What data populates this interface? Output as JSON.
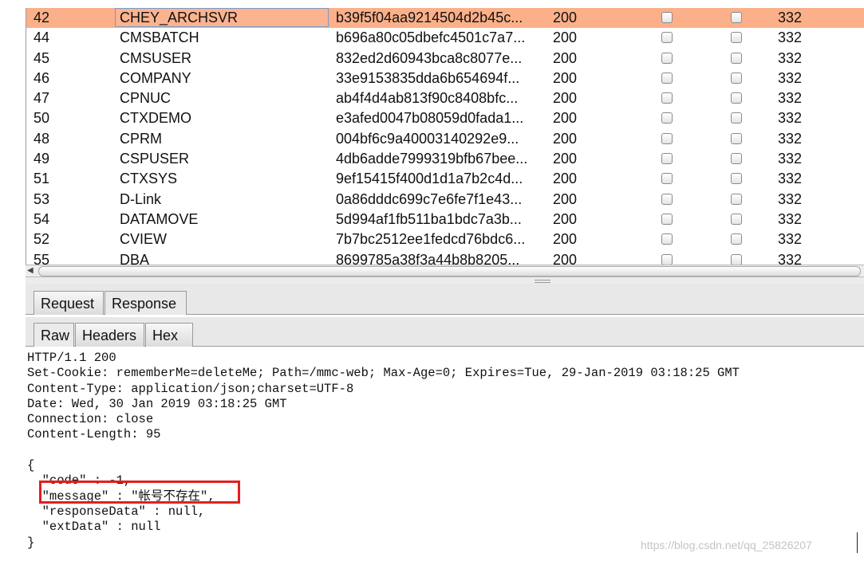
{
  "results": [
    {
      "num": "42",
      "user": "CHEY_ARCHSVR",
      "pass": "b39f5f04aa9214504d2b45c...",
      "status": "200",
      "len": "332"
    },
    {
      "num": "44",
      "user": "CMSBATCH",
      "pass": "b696a80c05dbefc4501c7a7...",
      "status": "200",
      "len": "332"
    },
    {
      "num": "45",
      "user": "CMSUSER",
      "pass": "832ed2d60943bca8c8077e...",
      "status": "200",
      "len": "332"
    },
    {
      "num": "46",
      "user": "COMPANY",
      "pass": "33e9153835dda6b654694f...",
      "status": "200",
      "len": "332"
    },
    {
      "num": "47",
      "user": "CPNUC",
      "pass": "ab4f4d4ab813f90c8408bfc...",
      "status": "200",
      "len": "332"
    },
    {
      "num": "50",
      "user": "CTXDEMO",
      "pass": "e3afed0047b08059d0fada1...",
      "status": "200",
      "len": "332"
    },
    {
      "num": "48",
      "user": "CPRM",
      "pass": "004bf6c9a40003140292e9...",
      "status": "200",
      "len": "332"
    },
    {
      "num": "49",
      "user": "CSPUSER",
      "pass": "4db6adde7999319bfb67bee...",
      "status": "200",
      "len": "332"
    },
    {
      "num": "51",
      "user": "CTXSYS",
      "pass": "9ef15415f400d1d1a7b2c4d...",
      "status": "200",
      "len": "332"
    },
    {
      "num": "53",
      "user": "D-Link",
      "pass": "0a86dddc699c7e6fe7f1e43...",
      "status": "200",
      "len": "332"
    },
    {
      "num": "54",
      "user": "DATAMOVE",
      "pass": "5d994af1fb511ba1bdc7a3b...",
      "status": "200",
      "len": "332"
    },
    {
      "num": "52",
      "user": "CVIEW",
      "pass": "7b7bc2512ee1fedcd76bdc6...",
      "status": "200",
      "len": "332"
    },
    {
      "num": "55",
      "user": "DBA",
      "pass": "8699785a38f3a44b8b8205...",
      "status": "200",
      "len": "332"
    }
  ],
  "tabs": {
    "request": "Request",
    "response": "Response"
  },
  "subtabs": {
    "raw": "Raw",
    "headers": "Headers",
    "hex": "Hex"
  },
  "response_lines": [
    "HTTP/1.1 200",
    "Set-Cookie: rememberMe=deleteMe; Path=/mmc-web; Max-Age=0; Expires=Tue, 29-Jan-2019 03:18:25 GMT",
    "Content-Type: application/json;charset=UTF-8",
    "Date: Wed, 30 Jan 2019 03:18:25 GMT",
    "Connection: close",
    "Content-Length: 95",
    "",
    "{",
    "  \"code\" : -1,",
    "  \"message\" : \"帐号不存在\",",
    "  \"responseData\" : null,",
    "  \"extData\" : null",
    "}"
  ],
  "watermark": "https://blog.csdn.net/qq_25826207",
  "colors": {
    "selected_row": "#fbb08a",
    "highlight_box": "#e0201f"
  }
}
